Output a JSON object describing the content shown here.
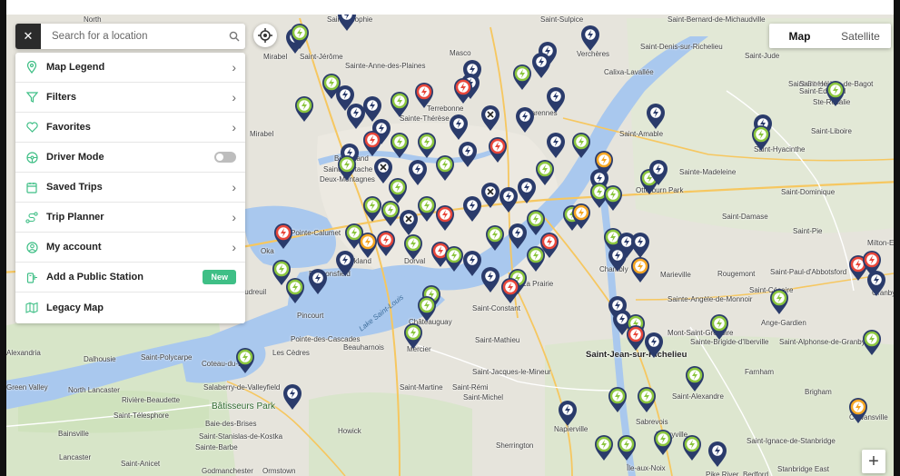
{
  "search": {
    "close_glyph": "✕",
    "placeholder": "Search for a location"
  },
  "map_type": {
    "map_label": "Map",
    "satellite_label": "Satellite",
    "selected": "Map"
  },
  "menu": {
    "items": [
      {
        "label": "Map Legend",
        "icon": "location-pin-icon"
      },
      {
        "label": "Filters",
        "icon": "filter-icon"
      },
      {
        "label": "Favorites",
        "icon": "heart-icon"
      },
      {
        "label": "Driver Mode",
        "icon": "steering-wheel-icon",
        "toggle": false
      },
      {
        "label": "Saved Trips",
        "icon": "saved-trips-icon"
      },
      {
        "label": "Trip Planner",
        "icon": "route-icon"
      },
      {
        "label": "My account",
        "icon": "account-icon"
      },
      {
        "label": "Add a Public Station",
        "icon": "add-station-icon",
        "badge": "New"
      },
      {
        "label": "Legacy Map",
        "icon": "legacy-map-icon"
      }
    ]
  },
  "zoom_in": "+",
  "colors": {
    "green_pin": "#8cc63f",
    "red_pin": "#e8473b",
    "orange_pin": "#f5a623",
    "navy_pin": "#2a3b6b",
    "accent_badge": "#3fbf86"
  },
  "map_labels": [
    "North",
    "Sainte-Sophie",
    "Saint-Sulpice",
    "Saint-Bernard-de-Michaudville",
    "Mirabel",
    "Saint-Jérôme",
    "Masco",
    "Verchères",
    "Saint-Denis-sur-Richelieu",
    "Saint-Jude",
    "Sainte-Anne-des-Plaines",
    "Terrebonne",
    "Varennes",
    "Calixa-Lavallée",
    "Sainte-Thérèse",
    "Saint-Simon",
    "Saint-Hélène-de-Bagot",
    "Saint-Édouard",
    "Mirabel",
    "Boisbriand",
    "Saint-Amable",
    "Saint-Hyacinthe",
    "Saint-Liboire",
    "Saint-Eustache",
    "Deux-Montagnes",
    "Sainte-Madeleine",
    "Otterburn Park",
    "Saint-Dominique",
    "Saint-Damase",
    "Pointe-Calumet",
    "Oka",
    "Kirkland",
    "Dorval",
    "Chambly",
    "Marieville",
    "Rougemont",
    "Saint-Paul-d'Abbotsford",
    "Saint-Césaire",
    "Sainte-Angèle-de-Monnoir",
    "Beaconsfield",
    "Vaudreuil",
    "Pincourt",
    "Châteauguay",
    "Saint-Constant",
    "La Prairie",
    "Lake Saint-Louis",
    "Les Cèdres",
    "Pointe-des-Cascades",
    "Beauharnois",
    "Saint-Mathieu",
    "Mercier",
    "Saint-Jean-sur-Richelieu",
    "Mont-Saint-Grégoire",
    "Sainte-Brigide-d'Iberville",
    "Ange-Gardien",
    "Saint-Alphonse-de-Granby",
    "Farnham",
    "Saint-Jacques-le-Mineur",
    "Saint-Rémi",
    "Saint-Michel",
    "Saint-Martine",
    "Saint-Alexandre",
    "Brigham",
    "Cowansville",
    "Dalhousie",
    "Saint-Polycarpe",
    "Coteau-du-Lac",
    "Salaberry-de-Valleyfield",
    "Bâtisseurs Park",
    "Green Valley",
    "North Lancaster",
    "Rivière-Beaudette",
    "Saint-Télesphore",
    "Baie-des-Brises",
    "Saint-Stanislas-de-Kostka",
    "Sainte-Barbe",
    "Howick",
    "Napierville",
    "Sabrevois",
    "Henryville",
    "Sherrington",
    "Saint-Ignace-de-Stanbridge",
    "Stanbridge East",
    "Bedford",
    "Pike River",
    "Île-aux-Noix",
    "Lancaster",
    "Saint-Anicet",
    "Godmanchester",
    "Ormstown",
    "Bainsville",
    "Alexandria",
    "Granby",
    "Milton-Est",
    "Saint-Pie",
    "Ste-Rosalie"
  ]
}
